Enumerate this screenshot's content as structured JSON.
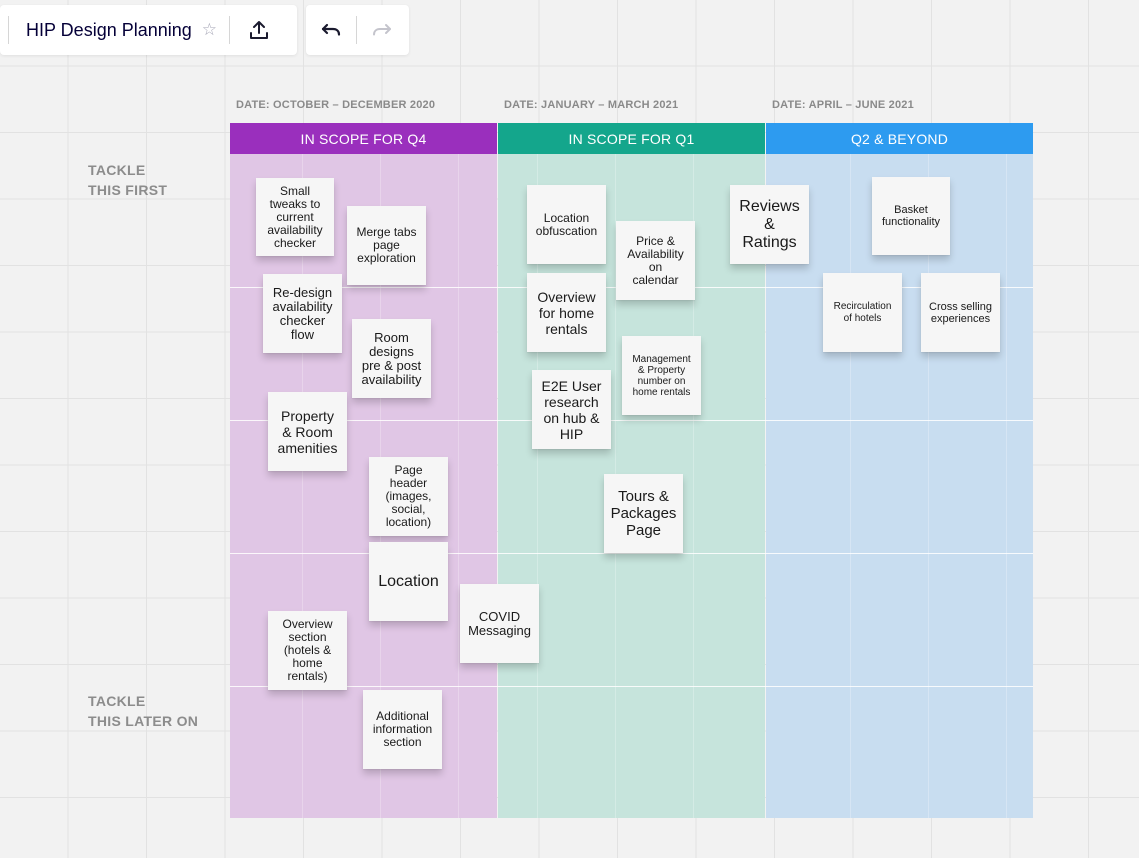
{
  "toolbar": {
    "title": "HIP Design Planning",
    "star_icon": "star-outline-icon",
    "export_icon": "upload-icon",
    "undo_icon": "undo-icon",
    "redo_icon": "redo-icon"
  },
  "board": {
    "columns": [
      {
        "date": "DATE: OCTOBER – DECEMBER 2020",
        "header": "IN SCOPE FOR Q4",
        "color": "#9a2fbd",
        "fill": "#e0c6e5"
      },
      {
        "date": "DATE: JANUARY – MARCH 2021",
        "header": "IN SCOPE FOR Q1",
        "color": "#14a68c",
        "fill": "#c6e4dc"
      },
      {
        "date": "DATE: APRIL – JUNE 2021",
        "header": "Q2 & BEYOND",
        "color": "#2d9bf0",
        "fill": "#c8ddf0"
      }
    ],
    "rows": {
      "first": "TACKLE\nTHIS FIRST",
      "later": "TACKLE\nTHIS LATER ON"
    }
  },
  "stickies": [
    {
      "id": "small-tweaks",
      "text": "Small\ntweaks to\ncurrent\navailability\nchecker"
    },
    {
      "id": "merge-tabs",
      "text": "Merge tabs\npage\nexploration"
    },
    {
      "id": "redesign-checker",
      "text": "Re-design\navailability\nchecker\nflow"
    },
    {
      "id": "room-designs",
      "text": "Room\ndesigns\npre & post\navailability"
    },
    {
      "id": "property-room-amenities",
      "text": "Property\n& Room\namenities"
    },
    {
      "id": "page-header",
      "text": "Page\nheader\n(images,\nsocial,\nlocation)"
    },
    {
      "id": "location",
      "text": "Location"
    },
    {
      "id": "overview-section",
      "text": "Overview\nsection\n(hotels &\nhome\nrentals)"
    },
    {
      "id": "additional-info",
      "text": "Additional\ninformation\nsection"
    },
    {
      "id": "covid-messaging",
      "text": "COVID\nMessaging"
    },
    {
      "id": "location-obfuscation",
      "text": "Location\nobfuscation"
    },
    {
      "id": "price-availability",
      "text": "Price &\nAvailability\non\ncalendar"
    },
    {
      "id": "overview-home-rentals",
      "text": "Overview\nfor home\nrentals"
    },
    {
      "id": "management-property",
      "text": "Management\n& Property\nnumber on\nhome rentals"
    },
    {
      "id": "e2e-research",
      "text": "E2E User\nresearch\non hub &\nHIP"
    },
    {
      "id": "tours-packages",
      "text": "Tours &\nPackages\nPage"
    },
    {
      "id": "reviews-ratings",
      "text": "Reviews\n&\nRatings"
    },
    {
      "id": "basket",
      "text": "Basket\nfunctionality"
    },
    {
      "id": "recirculation",
      "text": "Recirculation\nof hotels"
    },
    {
      "id": "cross-selling",
      "text": "Cross selling\nexperiences"
    }
  ]
}
